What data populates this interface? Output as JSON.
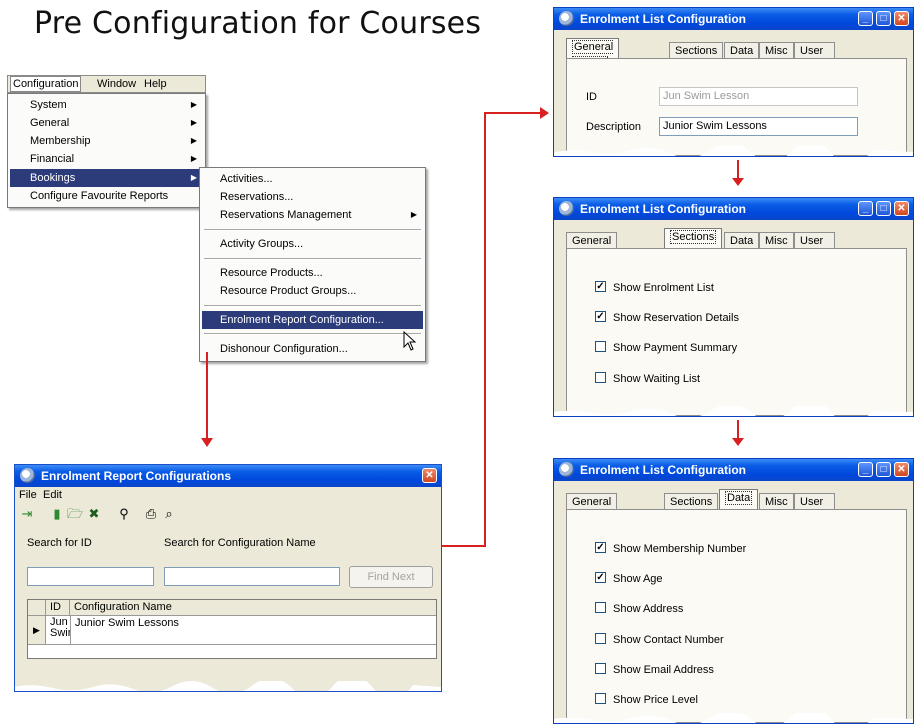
{
  "page_title": "Pre Configuration for Courses",
  "menubar": {
    "items": [
      "Configuration",
      "Window",
      "Help"
    ]
  },
  "config_menu": {
    "items": [
      "System",
      "General",
      "Membership",
      "Financial",
      "Bookings",
      "Configure Favourite Reports"
    ],
    "selected": "Bookings"
  },
  "bookings_menu": {
    "items": [
      "Activities...",
      "Reservations...",
      "Reservations Management",
      "Activity Groups...",
      "Resource Products...",
      "Resource Product Groups...",
      "Enrolment Report Configuration...",
      "Dishonour Configuration..."
    ],
    "selected": "Enrolment Report Configuration..."
  },
  "report_window": {
    "title": "Enrolment Report Configurations",
    "menu": [
      "File",
      "Edit"
    ],
    "search_id_label": "Search for ID",
    "search_name_label": "Search for Configuration Name",
    "find_next_label": "Find Next",
    "columns": [
      "ID",
      "Configuration Name"
    ],
    "rows": [
      {
        "id_line1": "Jun",
        "id_line2": "Swim",
        "name": "Junior Swim Lessons"
      }
    ]
  },
  "config_window": {
    "title": "Enrolment List Configuration",
    "tabs": [
      "General Details",
      "Sections",
      "Data",
      "Misc",
      "User Fields"
    ]
  },
  "general_tab": {
    "id_label": "ID",
    "id_value": "Jun Swim Lesson",
    "description_label": "Description",
    "description_value": "Junior Swim Lessons"
  },
  "sections_tab": {
    "options": [
      {
        "label": "Show Enrolment List",
        "checked": true
      },
      {
        "label": "Show Reservation Details",
        "checked": true
      },
      {
        "label": "Show Payment Summary",
        "checked": false
      },
      {
        "label": "Show Waiting List",
        "checked": false
      }
    ]
  },
  "data_tab": {
    "options": [
      {
        "label": "Show Membership Number",
        "checked": true
      },
      {
        "label": "Show Age",
        "checked": true
      },
      {
        "label": "Show Address",
        "checked": false
      },
      {
        "label": "Show Contact Number",
        "checked": false
      },
      {
        "label": "Show Email Address",
        "checked": false
      },
      {
        "label": "Show Price Level",
        "checked": false
      }
    ]
  },
  "colors": {
    "title_bar": "#0a5ce6",
    "menu_highlight": "#2c3c7a",
    "arrow": "#d82020",
    "dialog_bg": "#ece9d8"
  }
}
